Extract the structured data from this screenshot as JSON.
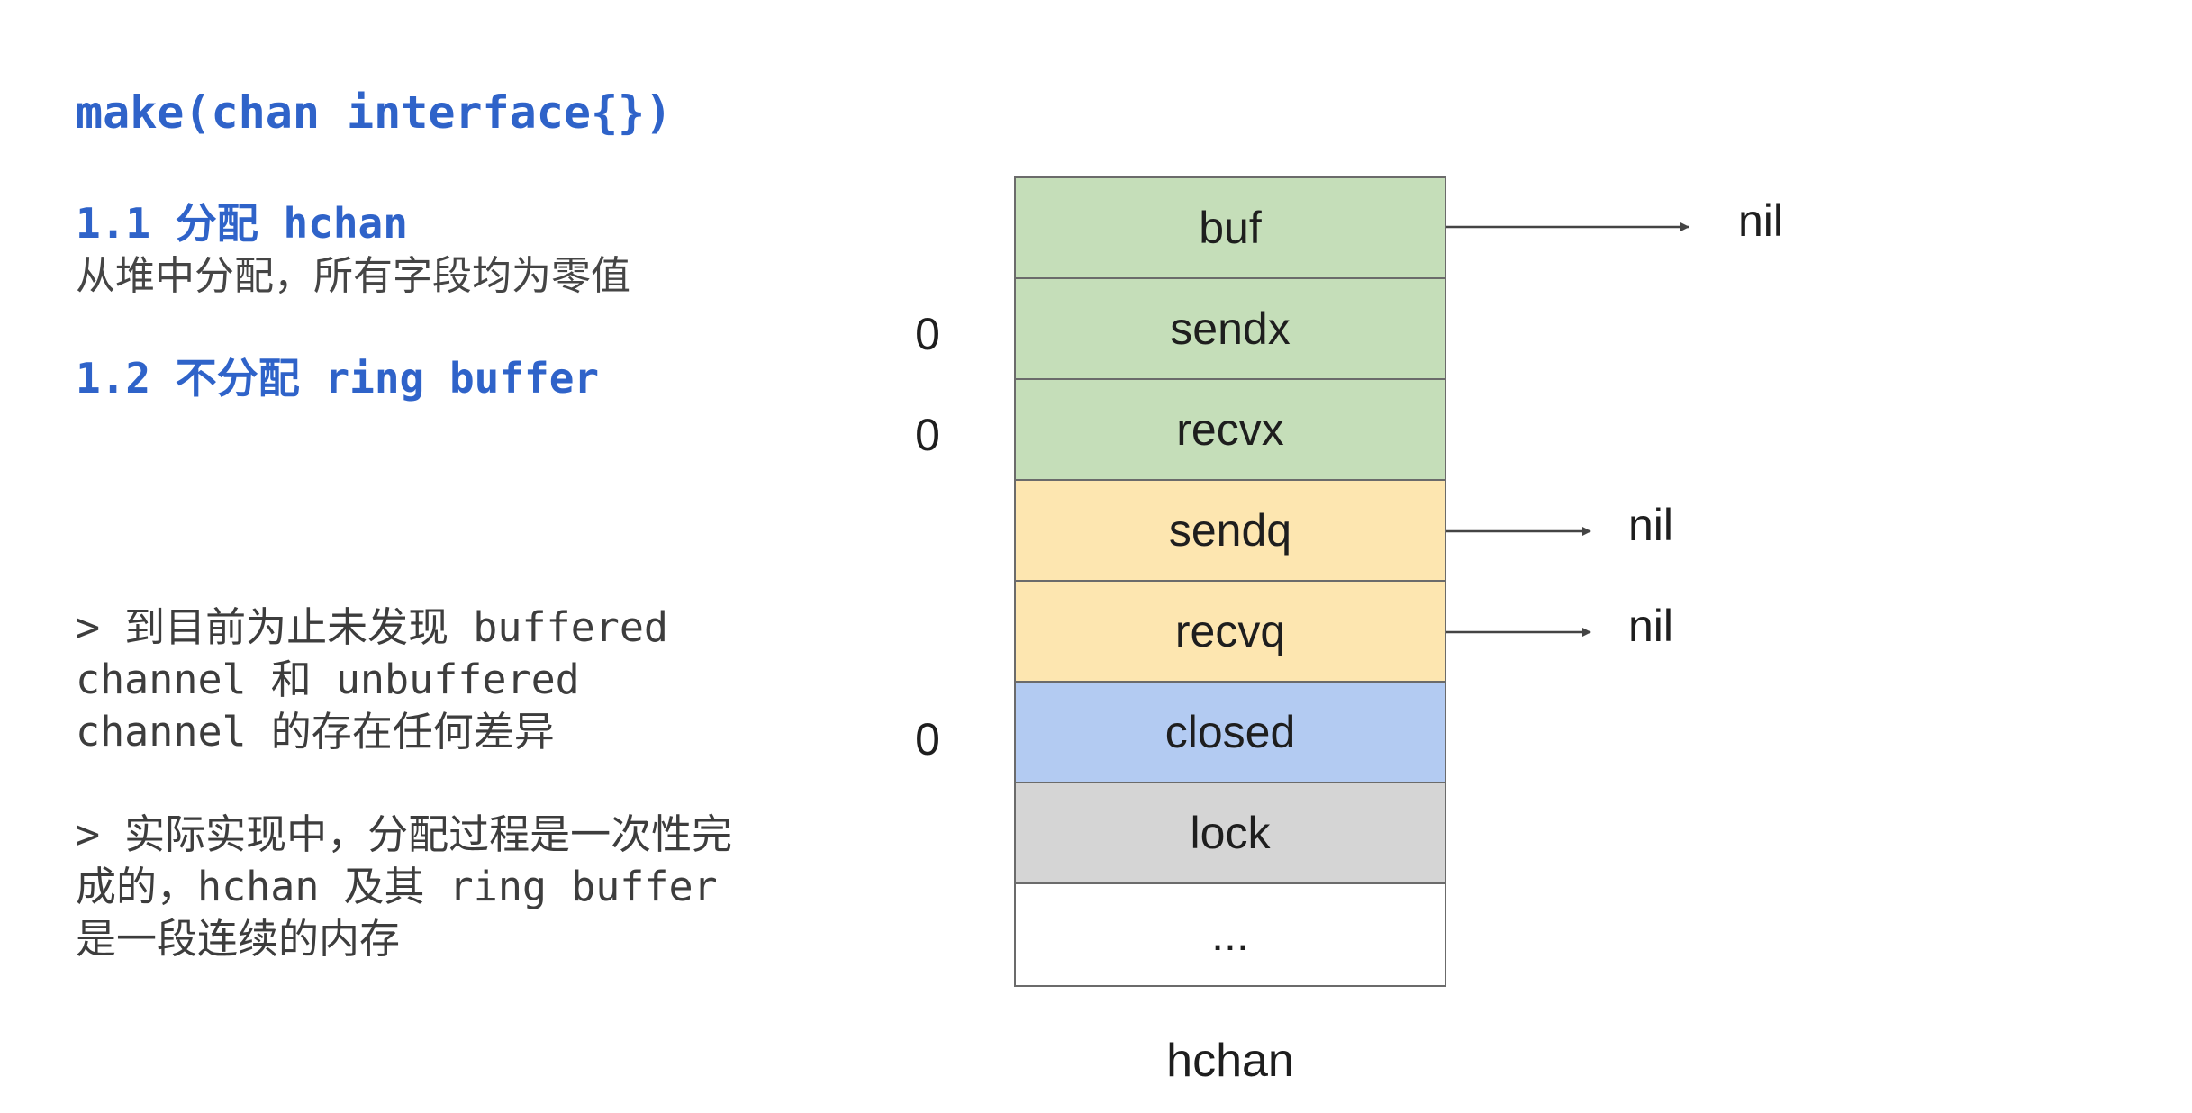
{
  "left": {
    "title": "make(chan interface{})",
    "step1": {
      "heading": "1.1 分配 hchan",
      "desc": "从堆中分配，所有字段均为零值"
    },
    "step2": {
      "heading": "1.2 不分配 ring buffer"
    },
    "note1": [
      "> 到目前为止未发现 buffered",
      "channel 和 unbuffered",
      "channel 的存在任何差异"
    ],
    "note2": [
      "> 实际实现中，分配过程是一次性完",
      "成的，hchan 及其 ring buffer",
      "是一段连续的内存"
    ]
  },
  "struct": {
    "caption": "hchan",
    "fields": [
      {
        "label": "buf",
        "color": "#c5deb9"
      },
      {
        "label": "sendx",
        "color": "#c5deb9"
      },
      {
        "label": "recvx",
        "color": "#c5deb9"
      },
      {
        "label": "sendq",
        "color": "#fde6b0"
      },
      {
        "label": "recvq",
        "color": "#fde6b0"
      },
      {
        "label": "closed",
        "color": "#b3cbf2"
      },
      {
        "label": "lock",
        "color": "#d5d5d5"
      },
      {
        "label": "...",
        "color": "#ffffff"
      }
    ]
  },
  "values": {
    "sendx": "0",
    "recvx": "0",
    "closed": "0"
  },
  "pointers": {
    "buf": "nil",
    "sendq": "nil",
    "recvq": "nil"
  }
}
